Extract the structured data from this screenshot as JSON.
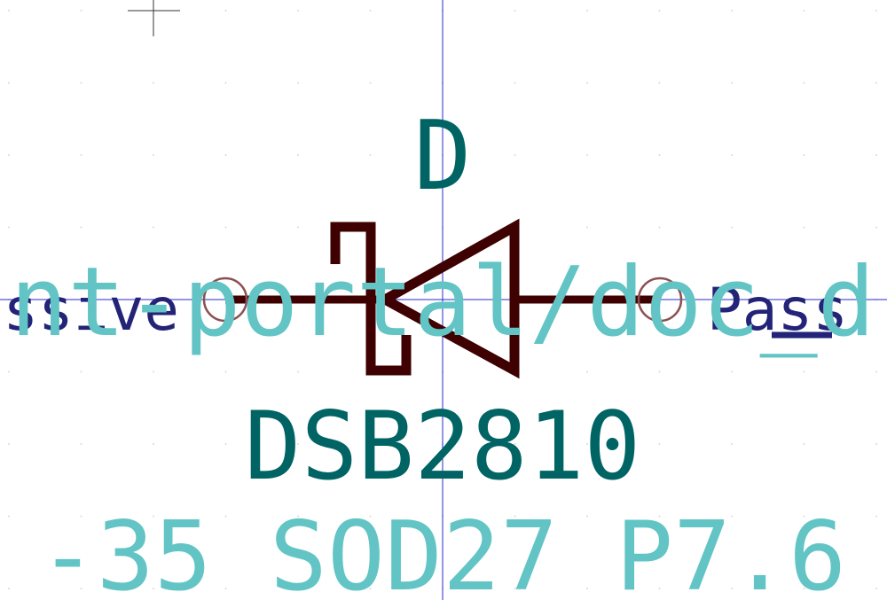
{
  "symbol": {
    "reference": "D",
    "value": "DSB2810",
    "footprint_fragment": "-35_SOD27_P7.6",
    "datasheet_fragment": "nt-portal/doc_d",
    "pin_left_type": "ssive",
    "pin_right_type": "Pass"
  },
  "colors": {
    "background": "#ffffff",
    "body": "#3e0000",
    "pin_line": "#3e0000",
    "pin_circle": "#8c5050",
    "reference": "#006464",
    "value": "#006464",
    "field_hidden": "#62c4c4",
    "pin_type": "#232378",
    "axis": "#2a2ad0",
    "grid_dot": "#d8d8d8",
    "cursor": "#333333"
  }
}
